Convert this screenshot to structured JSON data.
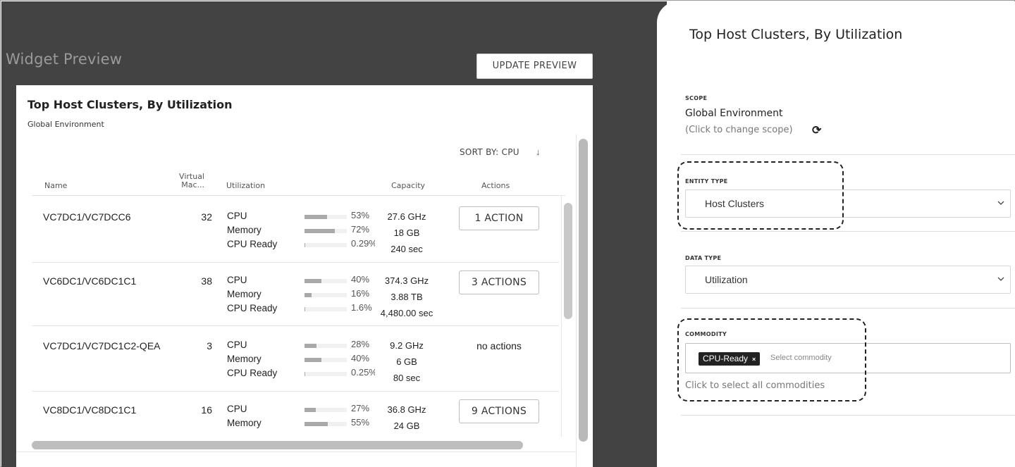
{
  "preview": {
    "title": "Widget Preview",
    "update_button": "UPDATE PREVIEW",
    "card_title": "Top Host Clusters, By Utilization",
    "card_subtitle": "Global Environment",
    "sort_label": "SORT BY: CPU",
    "sort_icon": "arrow-down-icon",
    "columns": {
      "name": "Name",
      "virtual_line1": "Virtual",
      "virtual_line2": "Mac...",
      "utilization": "Utilization",
      "capacity": "Capacity",
      "actions": "Actions"
    },
    "rows": [
      {
        "name": "VC7DC1/VC7DCC6",
        "vms": "32",
        "metrics": [
          {
            "label": "CPU",
            "pct_text": "53%",
            "pct": 53,
            "capacity": "27.6 GHz"
          },
          {
            "label": "Memory",
            "pct_text": "72%",
            "pct": 72,
            "capacity": "18 GB"
          },
          {
            "label": "CPU Ready",
            "pct_text": "0.29%",
            "pct": 0.29,
            "capacity": "240 sec"
          }
        ],
        "action": "1 ACTION"
      },
      {
        "name": "VC6DC1/VC6DC1C1",
        "vms": "38",
        "metrics": [
          {
            "label": "CPU",
            "pct_text": "40%",
            "pct": 40,
            "capacity": "374.3 GHz"
          },
          {
            "label": "Memory",
            "pct_text": "16%",
            "pct": 16,
            "capacity": "3.88 TB"
          },
          {
            "label": "CPU Ready",
            "pct_text": "1.6%",
            "pct": 1.6,
            "capacity": "4,480.00 sec"
          }
        ],
        "action": "3 ACTIONS"
      },
      {
        "name": "VC7DC1/VC7DC1C2-QEA",
        "vms": "3",
        "metrics": [
          {
            "label": "CPU",
            "pct_text": "28%",
            "pct": 28,
            "capacity": "9.2 GHz"
          },
          {
            "label": "Memory",
            "pct_text": "40%",
            "pct": 40,
            "capacity": "6 GB"
          },
          {
            "label": "CPU Ready",
            "pct_text": "0.25%",
            "pct": 0.25,
            "capacity": "80 sec"
          }
        ],
        "action_text": "no actions"
      },
      {
        "name": "VC8DC1/VC8DC1C1",
        "vms": "16",
        "metrics": [
          {
            "label": "CPU",
            "pct_text": "27%",
            "pct": 27,
            "capacity": "36.8 GHz"
          },
          {
            "label": "Memory",
            "pct_text": "55%",
            "pct": 55,
            "capacity": "24 GB"
          }
        ],
        "action": "9 ACTIONS"
      }
    ]
  },
  "panel": {
    "title": "Top Host Clusters, By Utilization",
    "scope_label": "SCOPE",
    "scope_value": "Global Environment",
    "scope_hint": "(Click to change scope)",
    "scope_icon": "refresh-icon",
    "entity_type_label": "ENTITY TYPE",
    "entity_type_value": "Host Clusters",
    "data_type_label": "DATA TYPE",
    "data_type_value": "Utilization",
    "commodity_label": "COMMODITY",
    "commodity_chip": "CPU-Ready",
    "commodity_chip_remove": "×",
    "commodity_placeholder": "Select commodity",
    "commodity_hint": "Click to select all commodities"
  }
}
